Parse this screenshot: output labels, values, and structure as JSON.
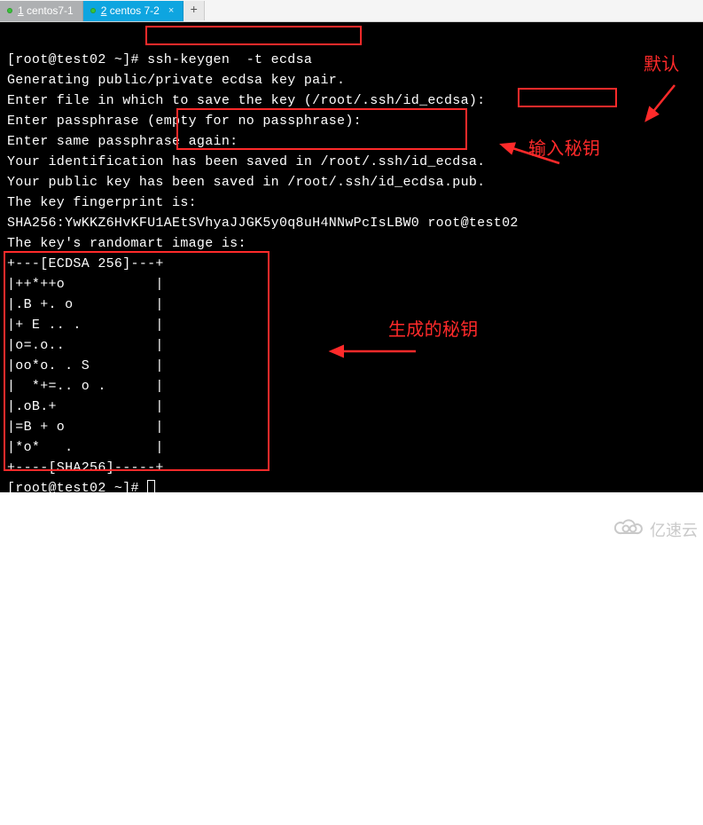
{
  "tabs": {
    "items": [
      {
        "num": "1",
        "label": "centos7-1",
        "active": false
      },
      {
        "num": "2",
        "label": "centos 7-2",
        "active": true
      }
    ],
    "new_tab_glyph": "+",
    "close_glyph": "×"
  },
  "terminal": {
    "prompt": "[root@test02 ~]#",
    "command": "ssh-keygen  -t ecdsa",
    "lines": [
      "Generating public/private ecdsa key pair.",
      "Enter file in which to save the key (/root/.ssh/id_ecdsa):",
      "Enter passphrase (empty for no passphrase):",
      "Enter same passphrase again:",
      "Your identification has been saved in /root/.ssh/id_ecdsa.",
      "Your public key has been saved in /root/.ssh/id_ecdsa.pub.",
      "The key fingerprint is:",
      "SHA256:YwKKZ6HvKFU1AEtSVhyaJJGK5y0q8uH4NNwPcIsLBW0 root@test02",
      "The key's randomart image is:",
      "+---[ECDSA 256]---+",
      "|++*++o           |",
      "|.B +. o          |",
      "|+ E .. .         |",
      "|o=.o..           |",
      "|oo*o. . S        |",
      "|  *+=.. o .      |",
      "|.oB.+            |",
      "|=B + o           |",
      "|*o*   .          |",
      "+----[SHA256]-----+"
    ],
    "final_prompt": "[root@test02 ~]# "
  },
  "annotations": {
    "default": "默认",
    "enter_key": "输入秘钥",
    "generated_key": "生成的秘钥"
  },
  "watermark": {
    "glyph": "ⓒ",
    "text": "亿速云"
  }
}
